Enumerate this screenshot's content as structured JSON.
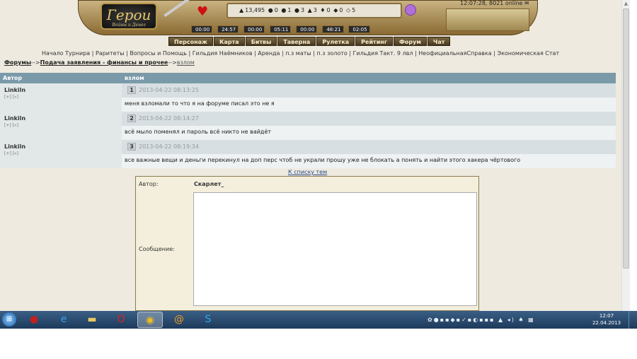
{
  "header": {
    "logo_title": "Герои",
    "logo_subtitle": "Войны и Денег",
    "clock": "12:07:28, 8021 online",
    "resources": [
      "13,495",
      "0",
      "1",
      "3",
      "3",
      "0",
      "0",
      "5"
    ],
    "timers": [
      {
        "label": "",
        "value": "00:00"
      },
      {
        "label": "",
        "value": "24:57"
      },
      {
        "label": "",
        "value": "00:00"
      },
      {
        "label": "",
        "value": "05:11"
      },
      {
        "label": "",
        "value": "00:00"
      },
      {
        "label": "",
        "value": "48:21"
      },
      {
        "label": "",
        "value": "02:05"
      }
    ],
    "nav": [
      "Персонаж",
      "Карта",
      "Битвы",
      "Таверна",
      "Рулетка",
      "Рейтинг",
      "Форум",
      "Чат"
    ]
  },
  "links": "Начало Турнира | Раритеты | Вопросы и Помощь | Гильдия Наёмников | Аренда | п.з маты | п.з золото | Гильдия Такт. 9 лвл | НеофициальнаяСправка | Экономическая Стат",
  "breadcrumb": {
    "forums": "Форумы",
    "sep": "-->",
    "section": "Подача заявления - финансы и прочее",
    "current": "взлом"
  },
  "table": {
    "col_author": "Автор",
    "col_topic": "взлом",
    "posts": [
      {
        "author": "Linkiln",
        "mini": "[+] [»]",
        "num": "1",
        "date": "2013-04-22 08:13:25",
        "text": "меня взломали то что я на форуме писал это не я"
      },
      {
        "author": "Linkiln",
        "mini": "[+] [»]",
        "num": "2",
        "date": "2013-04-22 08:14:27",
        "text": "всё мыло поменял и пароль всё никто не вайдёт"
      },
      {
        "author": "Linkiln",
        "mini": "[+] [»]",
        "num": "3",
        "date": "2013-04-22 08:19:34",
        "text": "все важные вещи и деньги перекинул на доп перс чтоб не украли прошу уже не блокать а понять и найти этого хакера чёртового"
      }
    ]
  },
  "to_list": "К списку тем",
  "form": {
    "author_label": "Автор:",
    "author_value": "Скарлет_",
    "message_label": "Сообщение:",
    "message_value": ""
  },
  "taskbar": {
    "time": "12:07",
    "date": "22.04.2013",
    "apps": [
      "ladybug-app-icon",
      "internet-explorer-icon",
      "explorer-folder-icon",
      "opera-icon",
      "chrome-icon",
      "mail-agent-icon",
      "skype-icon"
    ]
  }
}
